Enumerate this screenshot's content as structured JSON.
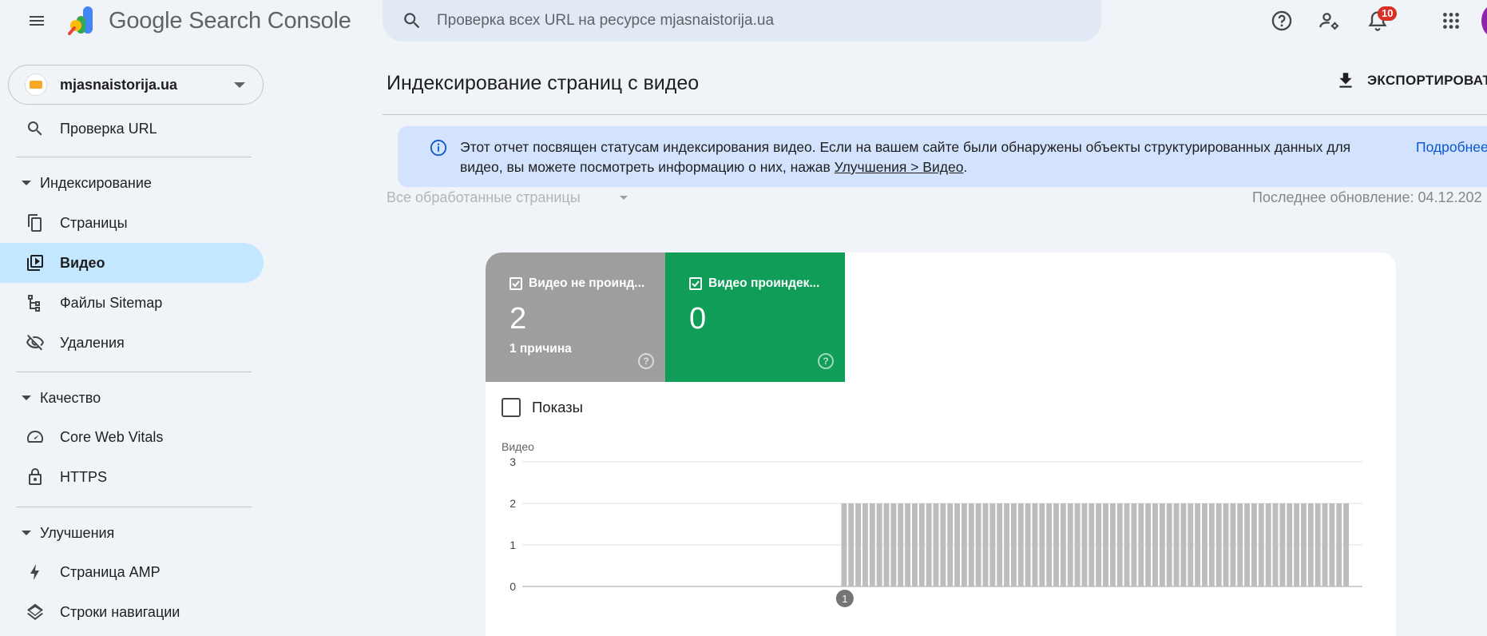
{
  "app": {
    "title_google": "Google",
    "title_product": "Search Console"
  },
  "search": {
    "placeholder": "Проверка всех URL на ресурсе mjasnaistorija.ua"
  },
  "topbar": {
    "notifications_count": "10"
  },
  "property": {
    "name": "mjasnaistorija.ua"
  },
  "sidebar": {
    "url_inspection": "Проверка URL",
    "indexing_section": "Индексирование",
    "indexing_items": [
      {
        "label": "Страницы",
        "icon": "pages-icon"
      },
      {
        "label": "Видео",
        "icon": "video-icon",
        "active": true
      },
      {
        "label": "Файлы Sitemap",
        "icon": "sitemap-icon"
      },
      {
        "label": "Удаления",
        "icon": "removals-icon"
      }
    ],
    "quality_section": "Качество",
    "quality_items": [
      {
        "label": "Core Web Vitals",
        "icon": "gauge-icon"
      },
      {
        "label": "HTTPS",
        "icon": "lock-icon"
      }
    ],
    "enhancements_section": "Улучшения",
    "enhancement_items": [
      {
        "label": "Страница AMP",
        "icon": "bolt-icon"
      },
      {
        "label": "Строки навигации",
        "icon": "layers-icon"
      }
    ]
  },
  "main": {
    "title": "Индексирование страниц с видео",
    "export_label": "ЭКСПОРТИРОВАТ",
    "info": {
      "text_before": "Этот отчет посвящен статусам индексирования видео. Если на вашем сайте были обнаружены объекты структурированных данных для видео, вы можете посмотреть информацию о них, нажав ",
      "link": "Улучшения > Видео",
      "text_after": ".",
      "more": "Подробнее"
    },
    "filter_label": "Все обработанные страницы",
    "last_updated_label": "Последнее обновление:",
    "last_updated_value": "04.12.202"
  },
  "summary": {
    "not_indexed": {
      "label": "Видео не проинд...",
      "value": "2",
      "sub": "1 причина",
      "color": "#9e9e9e"
    },
    "indexed": {
      "label": "Видео проиндек...",
      "value": "0",
      "color": "#0f9d58"
    },
    "impressions_label": "Показы"
  },
  "chart_data": {
    "type": "bar",
    "ylabel": "Видео",
    "ylim": [
      0,
      3
    ],
    "yticks": [
      "0",
      "1",
      "2",
      "3"
    ],
    "bar_color": "#bdbdbd",
    "annotation": "1",
    "values": [
      0,
      0,
      0,
      0,
      0,
      0,
      0,
      0,
      0,
      0,
      0,
      0,
      0,
      0,
      0,
      0,
      0,
      0,
      0,
      0,
      0,
      0,
      0,
      0,
      0,
      0,
      0,
      0,
      0,
      0,
      0,
      0,
      0,
      0,
      0,
      0,
      0,
      0,
      0,
      0,
      0,
      0,
      0,
      0,
      0,
      2,
      2,
      2,
      2,
      2,
      2,
      2,
      2,
      2,
      2,
      2,
      2,
      2,
      2,
      2,
      2,
      2,
      2,
      2,
      2,
      2,
      2,
      2,
      2,
      2,
      2,
      2,
      2,
      2,
      2,
      2,
      2,
      2,
      2,
      2,
      2,
      2,
      2,
      2,
      2,
      2,
      2,
      2,
      2,
      2,
      2,
      2,
      2,
      2,
      2,
      2,
      2,
      2,
      2,
      2,
      2,
      2,
      2,
      2,
      2,
      2,
      2,
      2,
      2,
      2,
      2,
      2,
      2,
      2,
      2,
      2,
      2
    ]
  }
}
